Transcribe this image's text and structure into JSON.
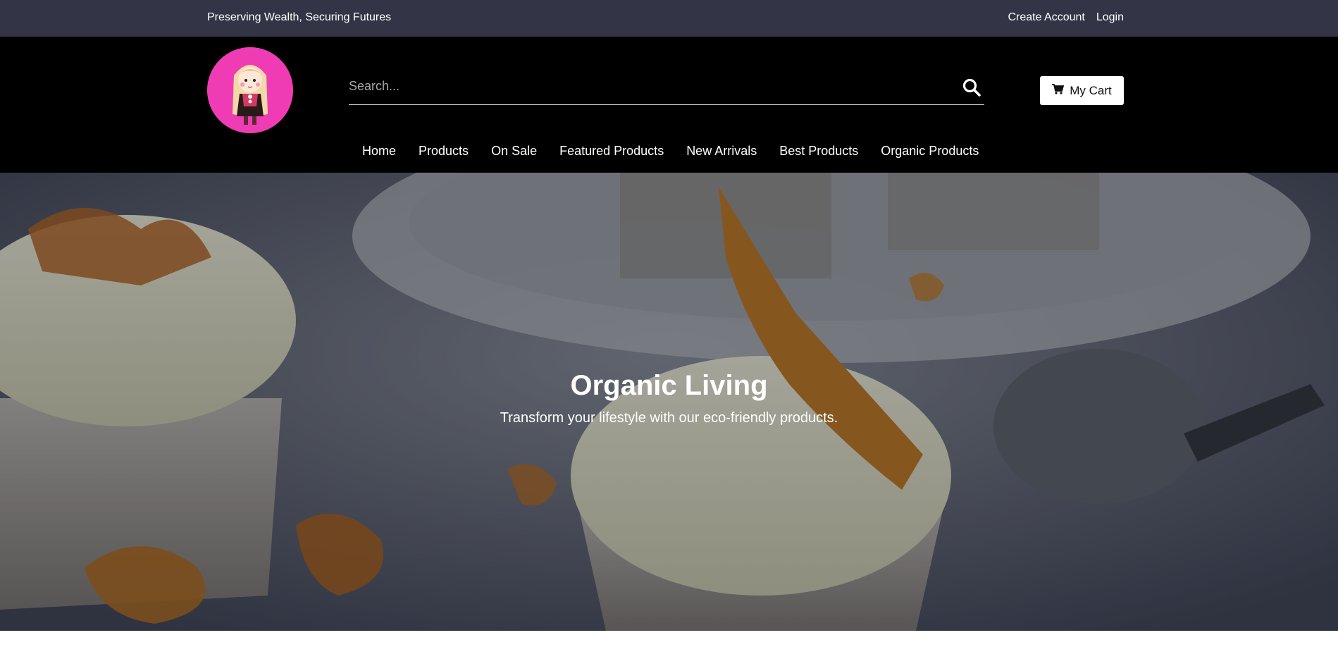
{
  "topbar": {
    "tagline": "Preserving Wealth, Securing Futures",
    "create_account": "Create Account",
    "login": "Login"
  },
  "header": {
    "logo_icon": "girl-mascot-logo",
    "search": {
      "placeholder": "Search...",
      "value": "",
      "icon": "search-icon"
    },
    "cart": {
      "label": "My Cart",
      "icon": "cart-icon"
    }
  },
  "nav": {
    "items": [
      {
        "label": "Home"
      },
      {
        "label": "Products"
      },
      {
        "label": "On Sale"
      },
      {
        "label": "Featured Products"
      },
      {
        "label": "New Arrivals"
      },
      {
        "label": "Best Products"
      },
      {
        "label": "Organic Products"
      }
    ]
  },
  "hero": {
    "title": "Organic Living",
    "subtitle": "Transform your lifestyle with our eco-friendly products."
  },
  "colors": {
    "topbar_bg": "#333547",
    "header_bg": "#000000",
    "logo_bg": "#f03cb4",
    "cart_bg": "#ffffff"
  }
}
